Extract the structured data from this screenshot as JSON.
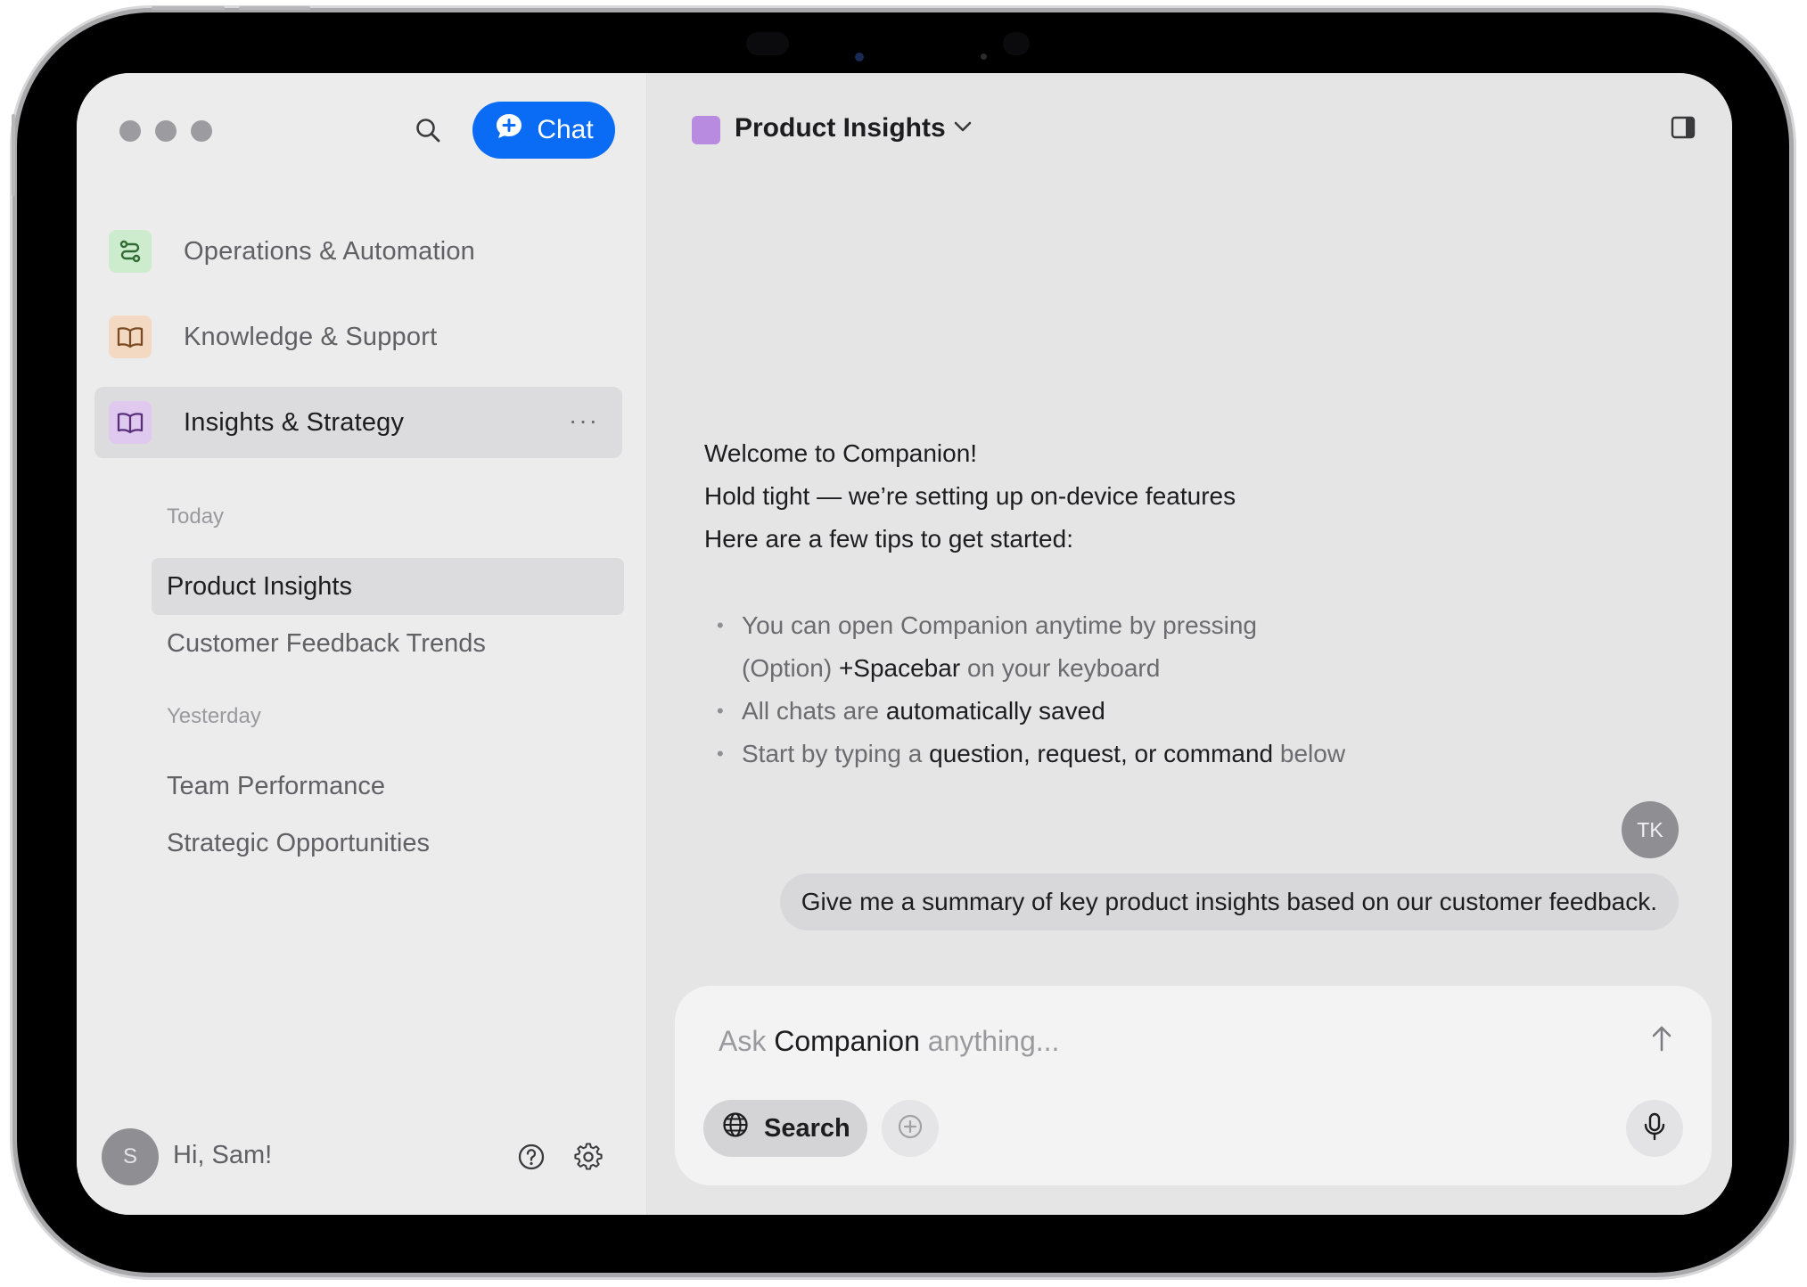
{
  "app": {
    "name": "Companion",
    "accent_color": "#0a6cf5"
  },
  "sidebar": {
    "chat_button_label": "Chat",
    "workspaces": [
      {
        "label": "Operations & Automation",
        "icon": "route-icon",
        "icon_bg": "#cdeccd"
      },
      {
        "label": "Knowledge & Support",
        "icon": "book-icon",
        "icon_bg": "#f4d9c2"
      },
      {
        "label": "Insights & Strategy",
        "icon": "book-icon",
        "icon_bg": "#dfc9ee",
        "selected": true
      }
    ],
    "more_label": "···",
    "sections": [
      {
        "title": "Today",
        "items": [
          {
            "label": "Product Insights",
            "selected": true
          },
          {
            "label": "Customer Feedback Trends"
          }
        ]
      },
      {
        "title": "Yesterday",
        "items": [
          {
            "label": "Team Performance"
          },
          {
            "label": "Strategic Opportunities"
          }
        ]
      }
    ],
    "user": {
      "initial": "S",
      "greeting": "Hi, Sam!"
    }
  },
  "header": {
    "project_title": "Product Insights",
    "project_color": "#b98be0"
  },
  "conversation": {
    "welcome": [
      "Welcome to Companion!",
      "Hold tight — we’re setting up on-device features",
      "Here are a few tips to get started:"
    ],
    "tips": {
      "tip1_a": "You can open Companion anytime by pressing",
      "tip1_b": "(Option)",
      "tip1_c": "+Spacebar",
      "tip1_d": "on your keyboard",
      "tip2_a": "All chats are",
      "tip2_b": "automatically saved",
      "tip3_a": "Start by typing a",
      "tip3_b": "question, request, or command",
      "tip3_c": "below"
    },
    "user_initials": "TK",
    "user_message": "Give me a summary of key product insights based on our customer feedback."
  },
  "composer": {
    "placeholder_a": "Ask",
    "placeholder_b": "Companion",
    "placeholder_c": "anything...",
    "search_label": "Search"
  }
}
